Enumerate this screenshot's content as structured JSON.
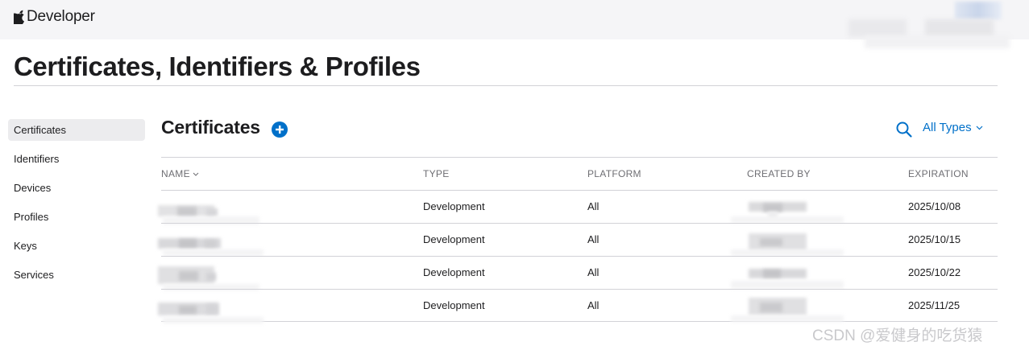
{
  "header": {
    "brand": "Developer"
  },
  "page": {
    "title": "Certificates, Identifiers & Profiles"
  },
  "sidebar": {
    "items": [
      {
        "label": "Certificates",
        "active": true
      },
      {
        "label": "Identifiers",
        "active": false
      },
      {
        "label": "Devices",
        "active": false
      },
      {
        "label": "Profiles",
        "active": false
      },
      {
        "label": "Keys",
        "active": false
      },
      {
        "label": "Services",
        "active": false
      }
    ]
  },
  "section": {
    "title": "Certificates",
    "add_icon": "plus-circle-icon",
    "search_icon": "search-icon",
    "filter_label": "All Types"
  },
  "table": {
    "columns": {
      "name": "NAME",
      "type": "TYPE",
      "platform": "PLATFORM",
      "created_by": "CREATED BY",
      "expiration": "EXPIRATION"
    },
    "rows": [
      {
        "type": "Development",
        "platform": "All",
        "expiration": "2025/10/08"
      },
      {
        "type": "Development",
        "platform": "All",
        "expiration": "2025/10/15"
      },
      {
        "type": "Development",
        "platform": "All",
        "expiration": "2025/10/22"
      },
      {
        "type": "Development",
        "platform": "All",
        "expiration": "2025/11/25"
      }
    ]
  },
  "watermark": "CSDN @爱健身的吃货猿",
  "colors": {
    "accent": "#0070c9",
    "topbar_bg": "#f5f5f7",
    "active_item_bg": "#ececee",
    "divider": "#d2d2d7",
    "muted_text": "#6e6e73"
  }
}
